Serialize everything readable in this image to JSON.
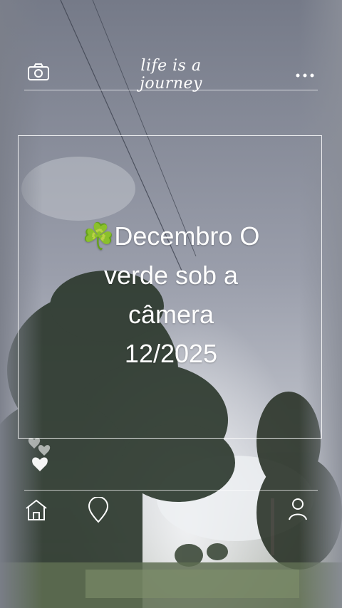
{
  "header": {
    "title": "life is a journey",
    "left_icon": "camera-icon",
    "right_icon": "more-dots-icon"
  },
  "post": {
    "caption_lines": [
      "☘️Decembro O",
      "verde sob a",
      "câmera",
      "12/2025"
    ]
  },
  "reactions": {
    "icons": [
      "hearts-icon"
    ]
  },
  "footer": {
    "icons": [
      "home-icon",
      "location-pin-icon",
      "profile-icon"
    ]
  },
  "colors": {
    "overlay_line": "#ffffff",
    "sky": "#8b8f9c",
    "foliage": "#2f3a2c"
  }
}
